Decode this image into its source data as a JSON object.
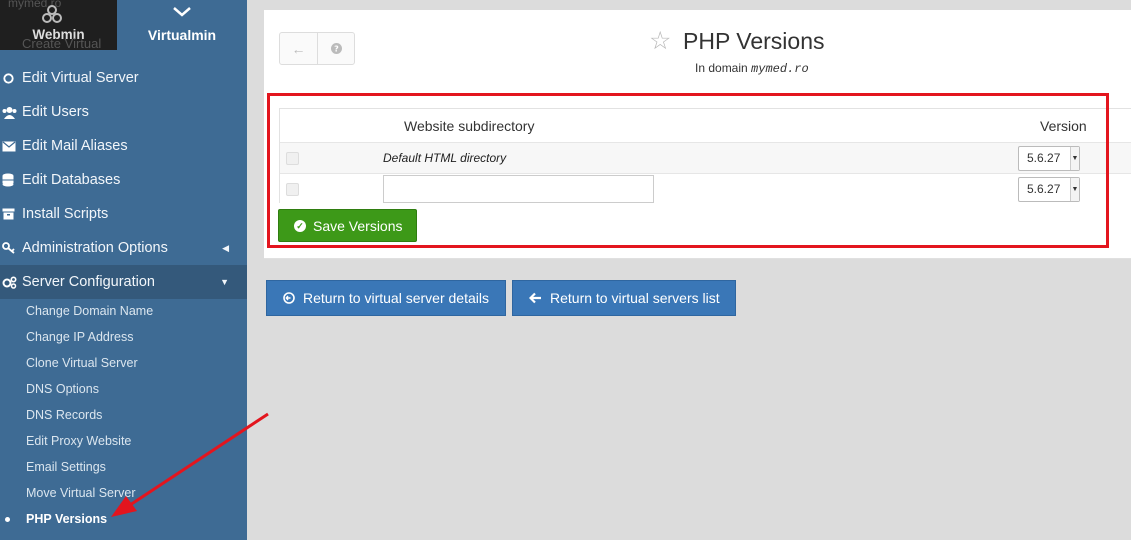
{
  "tabs": {
    "webmin": "Webmin",
    "virtualmin": "Virtualmin",
    "ghost_top": "mymed.ro",
    "ghost_bottom": "Create Virtual"
  },
  "sidebar": {
    "items": [
      {
        "label": "Edit Virtual Server",
        "icon": "gear-icon"
      },
      {
        "label": "Edit Users",
        "icon": "users-icon"
      },
      {
        "label": "Edit Mail Aliases",
        "icon": "envelope-icon"
      },
      {
        "label": "Edit Databases",
        "icon": "database-icon"
      },
      {
        "label": "Install Scripts",
        "icon": "box-icon"
      },
      {
        "label": "Administration Options",
        "icon": "key-icon"
      },
      {
        "label": "Server Configuration",
        "icon": "cogs-icon"
      }
    ],
    "sub_items": [
      "Change Domain Name",
      "Change IP Address",
      "Clone Virtual Server",
      "DNS Options",
      "DNS Records",
      "Edit Proxy Website",
      "Email Settings",
      "Move Virtual Server",
      "PHP Versions"
    ]
  },
  "header": {
    "title": "PHP Versions",
    "subtitle_prefix": "In domain",
    "domain": "mymed.ro"
  },
  "table": {
    "col_subdirectory": "Website subdirectory",
    "col_version": "Version",
    "rows": [
      {
        "directory": "Default HTML directory",
        "version": "5.6.27"
      },
      {
        "directory": "",
        "version": "5.6.27"
      }
    ]
  },
  "buttons": {
    "save": "Save Versions",
    "return_details": "Return to virtual server details",
    "return_list": "Return to virtual servers list"
  },
  "colors": {
    "sidebar": "#3e6b94",
    "save": "#3d9918",
    "primary": "#3a77b7",
    "highlight": "#e3151e"
  }
}
